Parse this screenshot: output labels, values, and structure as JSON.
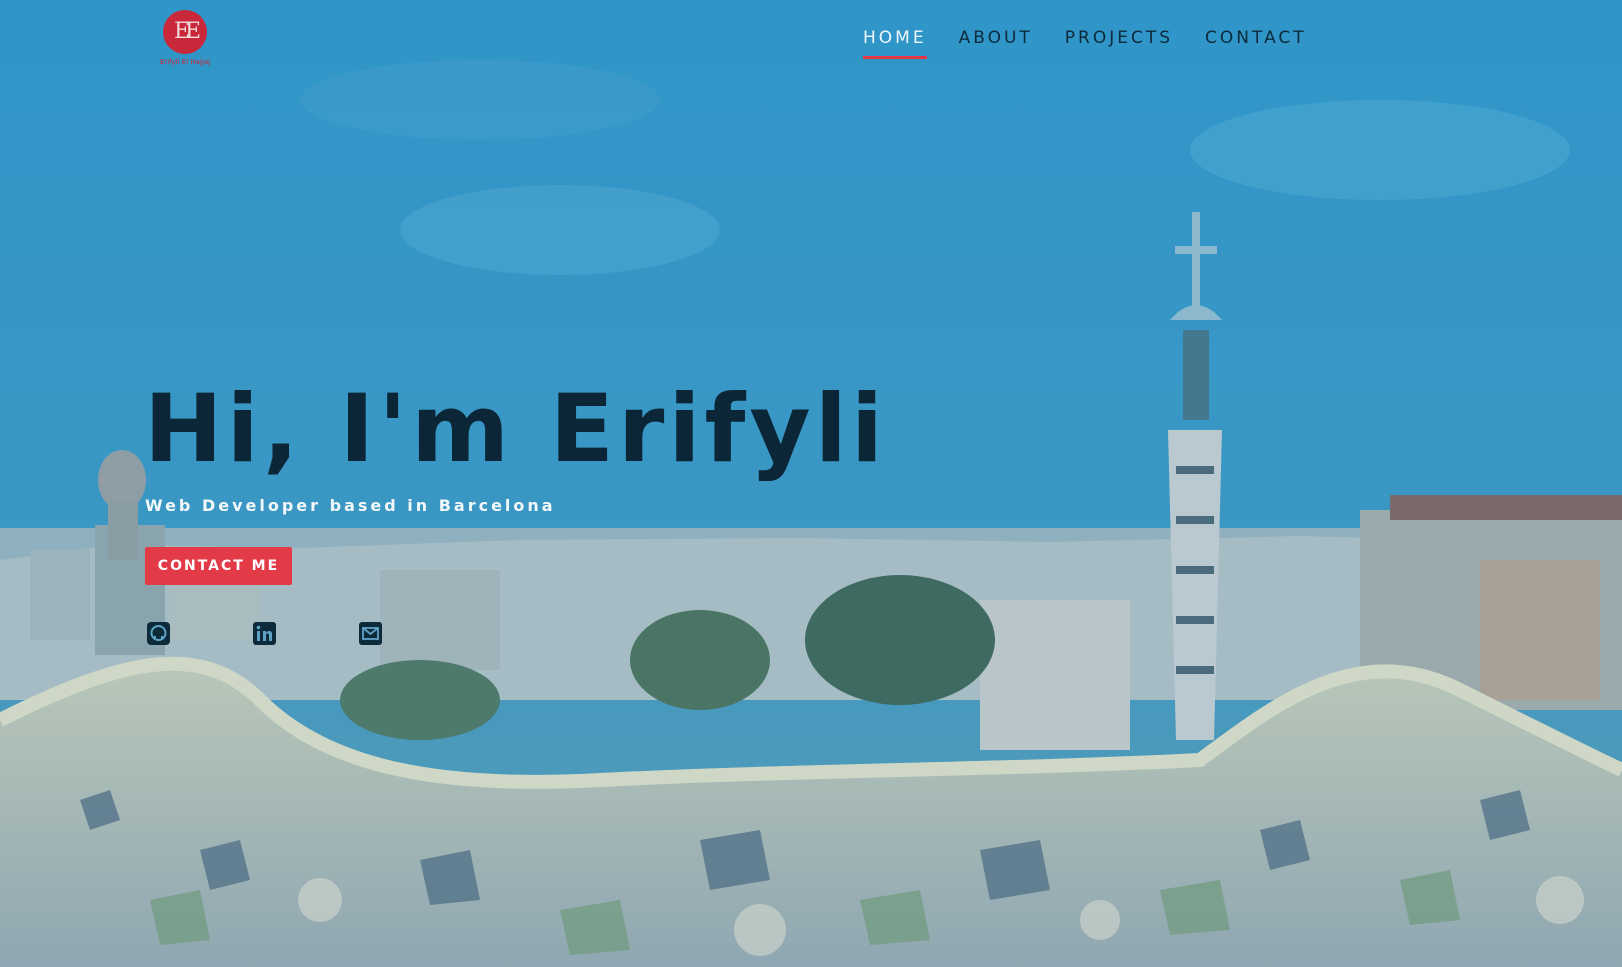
{
  "header": {
    "logo": {
      "initials": "EE",
      "tagline": "Erifyli El Hajjaj"
    },
    "nav": [
      {
        "label": "HOME",
        "active": true
      },
      {
        "label": "ABOUT",
        "active": false
      },
      {
        "label": "PROJECTS",
        "active": false
      },
      {
        "label": "CONTACT",
        "active": false
      }
    ]
  },
  "hero": {
    "title": "Hi, I'm Erifyli",
    "subtitle": "Web Developer based in Barcelona",
    "cta_label": "CONTACT ME",
    "social": [
      {
        "icon": "github-icon"
      },
      {
        "icon": "linkedin-icon"
      },
      {
        "icon": "envelope-icon"
      }
    ]
  },
  "colors": {
    "overlay": "#2f93c6",
    "accent": "#e23a47",
    "dark_text": "#0b2636",
    "light_text": "#f2f7fa"
  }
}
